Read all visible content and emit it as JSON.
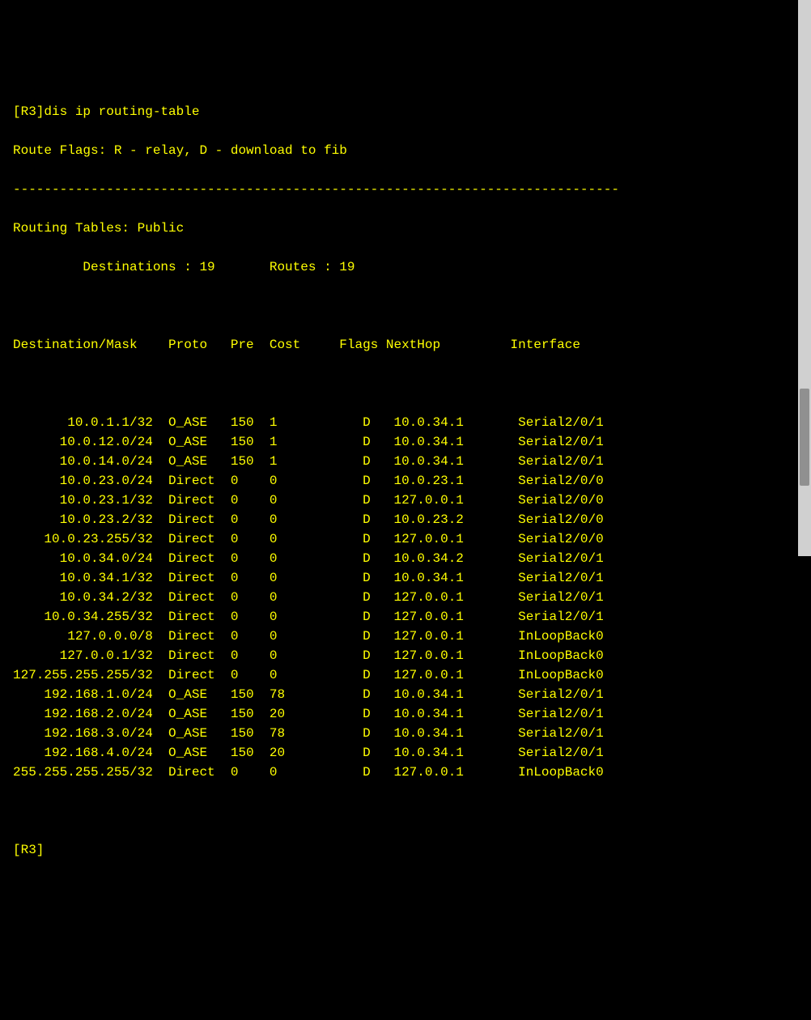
{
  "prompt1": "[R3]dis ip routing-table",
  "flags_line": "Route Flags: R - relay, D - download to fib",
  "separator": "------------------------------------------------------------------------------",
  "table_header": "Routing Tables: Public",
  "summary_line": "         Destinations : 19       Routes : 19",
  "columns": {
    "destination": "Destination/Mask",
    "proto": "Proto",
    "pre": "Pre",
    "cost": "Cost",
    "flags": "Flags",
    "nexthop": "NextHop",
    "interface": "Interface"
  },
  "routes": [
    {
      "destination": "10.0.1.1/32",
      "proto": "O_ASE",
      "pre": "150",
      "cost": "1",
      "flags": "D",
      "nexthop": "10.0.34.1",
      "interface": "Serial2/0/1"
    },
    {
      "destination": "10.0.12.0/24",
      "proto": "O_ASE",
      "pre": "150",
      "cost": "1",
      "flags": "D",
      "nexthop": "10.0.34.1",
      "interface": "Serial2/0/1"
    },
    {
      "destination": "10.0.14.0/24",
      "proto": "O_ASE",
      "pre": "150",
      "cost": "1",
      "flags": "D",
      "nexthop": "10.0.34.1",
      "interface": "Serial2/0/1"
    },
    {
      "destination": "10.0.23.0/24",
      "proto": "Direct",
      "pre": "0",
      "cost": "0",
      "flags": "D",
      "nexthop": "10.0.23.1",
      "interface": "Serial2/0/0"
    },
    {
      "destination": "10.0.23.1/32",
      "proto": "Direct",
      "pre": "0",
      "cost": "0",
      "flags": "D",
      "nexthop": "127.0.0.1",
      "interface": "Serial2/0/0"
    },
    {
      "destination": "10.0.23.2/32",
      "proto": "Direct",
      "pre": "0",
      "cost": "0",
      "flags": "D",
      "nexthop": "10.0.23.2",
      "interface": "Serial2/0/0"
    },
    {
      "destination": "10.0.23.255/32",
      "proto": "Direct",
      "pre": "0",
      "cost": "0",
      "flags": "D",
      "nexthop": "127.0.0.1",
      "interface": "Serial2/0/0"
    },
    {
      "destination": "10.0.34.0/24",
      "proto": "Direct",
      "pre": "0",
      "cost": "0",
      "flags": "D",
      "nexthop": "10.0.34.2",
      "interface": "Serial2/0/1"
    },
    {
      "destination": "10.0.34.1/32",
      "proto": "Direct",
      "pre": "0",
      "cost": "0",
      "flags": "D",
      "nexthop": "10.0.34.1",
      "interface": "Serial2/0/1"
    },
    {
      "destination": "10.0.34.2/32",
      "proto": "Direct",
      "pre": "0",
      "cost": "0",
      "flags": "D",
      "nexthop": "127.0.0.1",
      "interface": "Serial2/0/1"
    },
    {
      "destination": "10.0.34.255/32",
      "proto": "Direct",
      "pre": "0",
      "cost": "0",
      "flags": "D",
      "nexthop": "127.0.0.1",
      "interface": "Serial2/0/1"
    },
    {
      "destination": "127.0.0.0/8",
      "proto": "Direct",
      "pre": "0",
      "cost": "0",
      "flags": "D",
      "nexthop": "127.0.0.1",
      "interface": "InLoopBack0"
    },
    {
      "destination": "127.0.0.1/32",
      "proto": "Direct",
      "pre": "0",
      "cost": "0",
      "flags": "D",
      "nexthop": "127.0.0.1",
      "interface": "InLoopBack0"
    },
    {
      "destination": "127.255.255.255/32",
      "proto": "Direct",
      "pre": "0",
      "cost": "0",
      "flags": "D",
      "nexthop": "127.0.0.1",
      "interface": "InLoopBack0"
    },
    {
      "destination": "192.168.1.0/24",
      "proto": "O_ASE",
      "pre": "150",
      "cost": "78",
      "flags": "D",
      "nexthop": "10.0.34.1",
      "interface": "Serial2/0/1"
    },
    {
      "destination": "192.168.2.0/24",
      "proto": "O_ASE",
      "pre": "150",
      "cost": "20",
      "flags": "D",
      "nexthop": "10.0.34.1",
      "interface": "Serial2/0/1"
    },
    {
      "destination": "192.168.3.0/24",
      "proto": "O_ASE",
      "pre": "150",
      "cost": "78",
      "flags": "D",
      "nexthop": "10.0.34.1",
      "interface": "Serial2/0/1"
    },
    {
      "destination": "192.168.4.0/24",
      "proto": "O_ASE",
      "pre": "150",
      "cost": "20",
      "flags": "D",
      "nexthop": "10.0.34.1",
      "interface": "Serial2/0/1"
    },
    {
      "destination": "255.255.255.255/32",
      "proto": "Direct",
      "pre": "0",
      "cost": "0",
      "flags": "D",
      "nexthop": "127.0.0.1",
      "interface": "InLoopBack0"
    }
  ],
  "prompt2": "[R3]"
}
